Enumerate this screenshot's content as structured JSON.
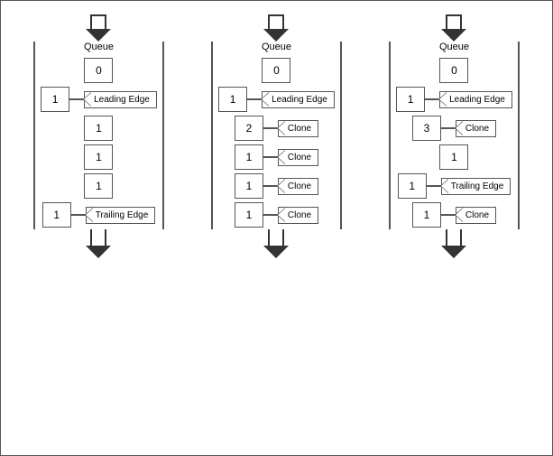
{
  "diagrams": [
    {
      "id": "diagram1",
      "queue_label": "Queue",
      "cells": [
        {
          "value": "0",
          "label": null
        },
        {
          "value": "1",
          "label": "Leading Edge"
        },
        {
          "value": "1",
          "label": null
        },
        {
          "value": "1",
          "label": null
        },
        {
          "value": "1",
          "label": null
        },
        {
          "value": "1",
          "label": "Trailing Edge"
        }
      ]
    },
    {
      "id": "diagram2",
      "queue_label": "Queue",
      "cells": [
        {
          "value": "0",
          "label": null
        },
        {
          "value": "1",
          "label": "Leading Edge"
        },
        {
          "value": "2",
          "label": "Clone"
        },
        {
          "value": "1",
          "label": "Clone"
        },
        {
          "value": "1",
          "label": "Clone"
        },
        {
          "value": "1",
          "label": "Clone"
        }
      ]
    },
    {
      "id": "diagram3",
      "queue_label": "Queue",
      "cells": [
        {
          "value": "0",
          "label": null
        },
        {
          "value": "1",
          "label": "Leading Edge"
        },
        {
          "value": "3",
          "label": "Clone"
        },
        {
          "value": "1",
          "label": null
        },
        {
          "value": "1",
          "label": "Trailing Edge"
        },
        {
          "value": "1",
          "label": "Clone"
        }
      ]
    }
  ]
}
